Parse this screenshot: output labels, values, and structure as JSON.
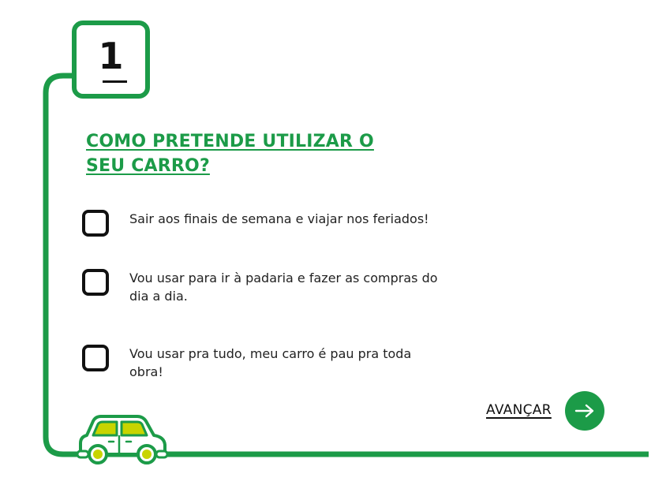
{
  "step": {
    "number": "1"
  },
  "question": {
    "title": "COMO PRETENDE UTILIZAR O SEU CARRO?"
  },
  "options": [
    {
      "label": "Sair aos finais de semana e viajar nos feriados!",
      "checked": false
    },
    {
      "label": "Vou usar para ir à padaria e fazer as compras do dia a dia.",
      "checked": false
    },
    {
      "label": "Vou usar pra tudo, meu carro é pau pra toda obra!",
      "checked": false
    }
  ],
  "navigation": {
    "advance_label": "AVANÇAR",
    "advance_icon": "arrow-right-icon"
  },
  "colors": {
    "brand_green": "#1c9b48",
    "car_window_yellow": "#c8d400",
    "text_dark": "#111111"
  }
}
